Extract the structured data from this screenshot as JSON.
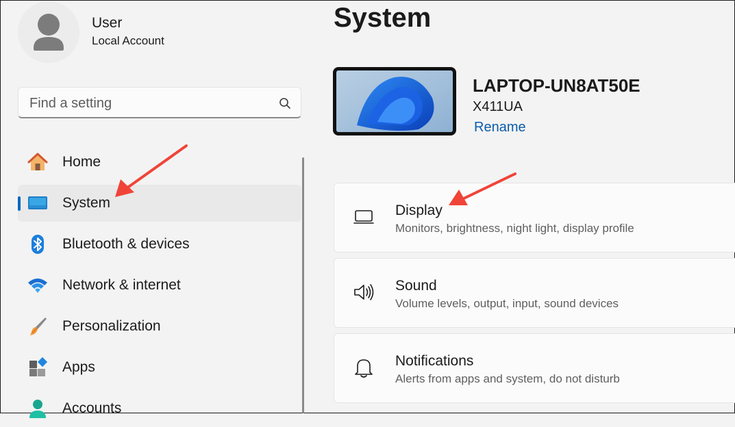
{
  "user": {
    "name": "User",
    "account_type": "Local Account"
  },
  "search": {
    "placeholder": "Find a setting"
  },
  "sidebar": {
    "items": [
      {
        "label": "Home",
        "icon": "home-icon",
        "selected": false
      },
      {
        "label": "System",
        "icon": "system-display-icon",
        "selected": true
      },
      {
        "label": "Bluetooth & devices",
        "icon": "bluetooth-icon",
        "selected": false
      },
      {
        "label": "Network & internet",
        "icon": "wifi-icon",
        "selected": false
      },
      {
        "label": "Personalization",
        "icon": "paintbrush-icon",
        "selected": false
      },
      {
        "label": "Apps",
        "icon": "apps-icon",
        "selected": false
      },
      {
        "label": "Accounts",
        "icon": "accounts-icon",
        "selected": false
      }
    ]
  },
  "main": {
    "title": "System",
    "device": {
      "name": "LAPTOP-UN8AT50E",
      "model": "X411UA",
      "rename_label": "Rename"
    },
    "cards": [
      {
        "title": "Display",
        "subtitle": "Monitors, brightness, night light, display profile",
        "icon": "laptop-icon"
      },
      {
        "title": "Sound",
        "subtitle": "Volume levels, output, input, sound devices",
        "icon": "speaker-icon"
      },
      {
        "title": "Notifications",
        "subtitle": "Alerts from apps and system, do not disturb",
        "icon": "bell-icon"
      }
    ]
  },
  "colors": {
    "accent": "#0067c0",
    "annotation_arrow": "#f04438",
    "link": "#0b5cab"
  }
}
